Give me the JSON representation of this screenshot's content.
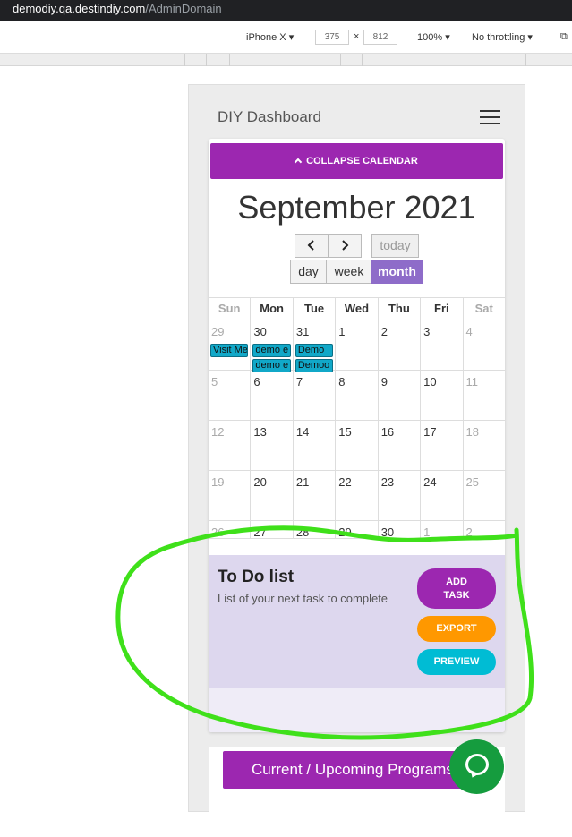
{
  "browser": {
    "host": "demodiy.qa.destindiy.com",
    "path": "/AdminDomain"
  },
  "device_toolbar": {
    "device": "iPhone X",
    "width": "375",
    "height": "812",
    "times": "×",
    "zoom": "100%",
    "throttle": "No throttling"
  },
  "header": {
    "title": "DIY Dashboard"
  },
  "calendar": {
    "collapse_label": "COLLAPSE CALENDAR",
    "month_title": "September 2021",
    "buttons": {
      "today": "today",
      "day": "day",
      "week": "week",
      "month": "month"
    },
    "weekdays": [
      "Sun",
      "Mon",
      "Tue",
      "Wed",
      "Thu",
      "Fri",
      "Sat"
    ],
    "weeks": [
      [
        "29",
        "30",
        "31",
        "1",
        "2",
        "3",
        "4"
      ],
      [
        "5",
        "6",
        "7",
        "8",
        "9",
        "10",
        "11"
      ],
      [
        "12",
        "13",
        "14",
        "15",
        "16",
        "17",
        "18"
      ],
      [
        "19",
        "20",
        "21",
        "22",
        "23",
        "24",
        "25"
      ],
      [
        "26",
        "27",
        "28",
        "29",
        "30",
        "1",
        "2"
      ]
    ],
    "events": {
      "sun_29": "Visit Me",
      "mon_30_a": "demo e",
      "mon_30_b": "demo e",
      "tue_31_a": "Demo",
      "tue_31_b": "Demoo"
    }
  },
  "todo": {
    "title": "To Do list",
    "subtitle": "List of your next task to complete",
    "add_line1": "ADD",
    "add_line2": "TASK",
    "export": "EXPORT",
    "preview": "PREVIEW"
  },
  "programs": {
    "label": "Current / Upcoming Programs"
  },
  "colors": {
    "accent_purple": "#9c27b0",
    "month_active": "#8e6cc9",
    "export_orange": "#ff9800",
    "preview_cyan": "#00bcd4",
    "event_blue": "#11a8c8",
    "chat_green": "#159c3e",
    "annotation_green": "#3fe01a"
  },
  "icons": {
    "menu": "hamburger-icon",
    "prev": "chevron-left-icon",
    "next": "chevron-right-icon",
    "collapse": "chevron-up-icon",
    "chat": "chat-bubble-icon"
  }
}
